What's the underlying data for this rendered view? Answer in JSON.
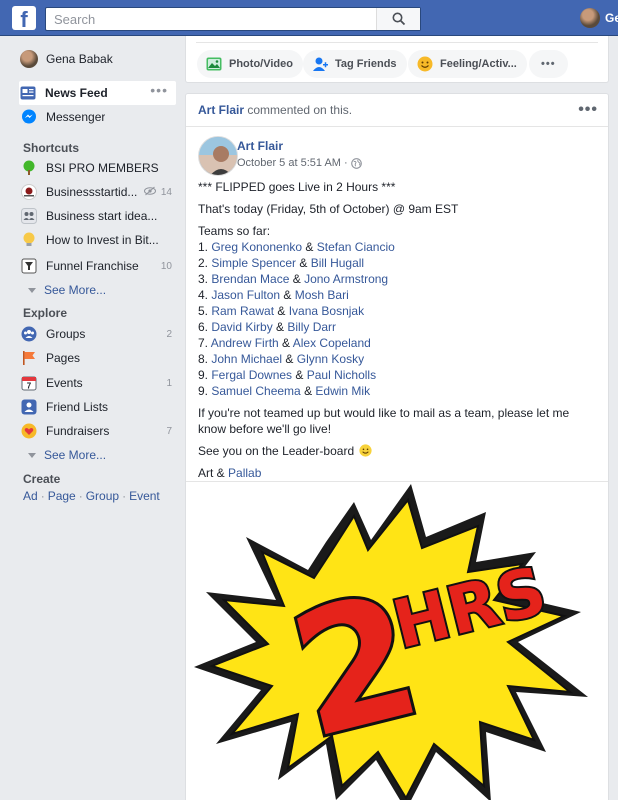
{
  "topbar": {
    "logo": "f",
    "search_placeholder": "Search",
    "user_name_short": "Ge",
    "search_icon": "search-icon"
  },
  "leftnav": {
    "profile_name": "Gena Babak",
    "news_feed": "News Feed",
    "messenger": "Messenger",
    "shortcuts_heading": "Shortcuts",
    "shortcuts": [
      {
        "label": "BSI PRO MEMBERS",
        "count": ""
      },
      {
        "label": "Businessstartid...",
        "count": "14"
      },
      {
        "label": "Business start idea...",
        "count": ""
      },
      {
        "label": "How to Invest in Bit...",
        "count": ""
      },
      {
        "label": "Funnel Franchise",
        "count": "10"
      }
    ],
    "see_more": "See More...",
    "explore_heading": "Explore",
    "explore": [
      {
        "label": "Groups",
        "count": "2"
      },
      {
        "label": "Pages",
        "count": ""
      },
      {
        "label": "Events",
        "count": "1"
      },
      {
        "label": "Friend Lists",
        "count": ""
      },
      {
        "label": "Fundraisers",
        "count": "7"
      }
    ],
    "see_more_2": "See More...",
    "create_heading": "Create",
    "create_links": [
      "Ad",
      "Page",
      "Group",
      "Event"
    ]
  },
  "composer": {
    "photo_video": "Photo/Video",
    "tag_friends": "Tag Friends",
    "feeling": "Feeling/Activ...",
    "more": "•••"
  },
  "post": {
    "header_actor": "Art Flair",
    "header_action": " commented on this.",
    "author": "Art Flair",
    "timestamp": "October 5 at 5:51 AM",
    "timestamp_sep": " · ",
    "line1": "*** FLIPPED goes Live in 2 Hours ***",
    "line2": "That's today (Friday, 5th of October) @ 9am EST",
    "teams_heading": "Teams so far:",
    "teams": [
      {
        "num": "1. ",
        "a": "Greg Kononenko",
        "b": "Stefan Ciancio"
      },
      {
        "num": "2. ",
        "a": "Simple Spencer",
        "b": "Bill Hugall"
      },
      {
        "num": "3. ",
        "a": "Brendan Mace",
        "b": "Jono Armstrong"
      },
      {
        "num": "4. ",
        "a": "Jason Fulton",
        "b": "Mosh Bari"
      },
      {
        "num": "5. ",
        "a": "Ram Rawat",
        "b": "Ivana Bosnjak"
      },
      {
        "num": "6. ",
        "a": "David Kirby",
        "b": "Billy Darr"
      },
      {
        "num": "7. ",
        "a": "Andrew Firth",
        "b": "Alex Copeland"
      },
      {
        "num": "8. ",
        "a": "John Michael",
        "b": "Glynn Kosky"
      },
      {
        "num": "9. ",
        "a": "Fergal Downes",
        "b": "Paul Nicholls"
      },
      {
        "num": "9. ",
        "a": "Samuel Cheema",
        "b": "Edwin Mik"
      }
    ],
    "amp": " & ",
    "line3": "If you're not teamed up but would like to mail as a team, please let me know before we'll go live!",
    "line4": "See you on the Leader-board",
    "sign_a": "Art & ",
    "sign_b": "Pallab",
    "image_text": "2HRS"
  },
  "colors": {
    "brand_blue": "#4267b2",
    "link": "#365899",
    "burst_yellow": "#ffe415",
    "burst_red": "#e5231b"
  }
}
